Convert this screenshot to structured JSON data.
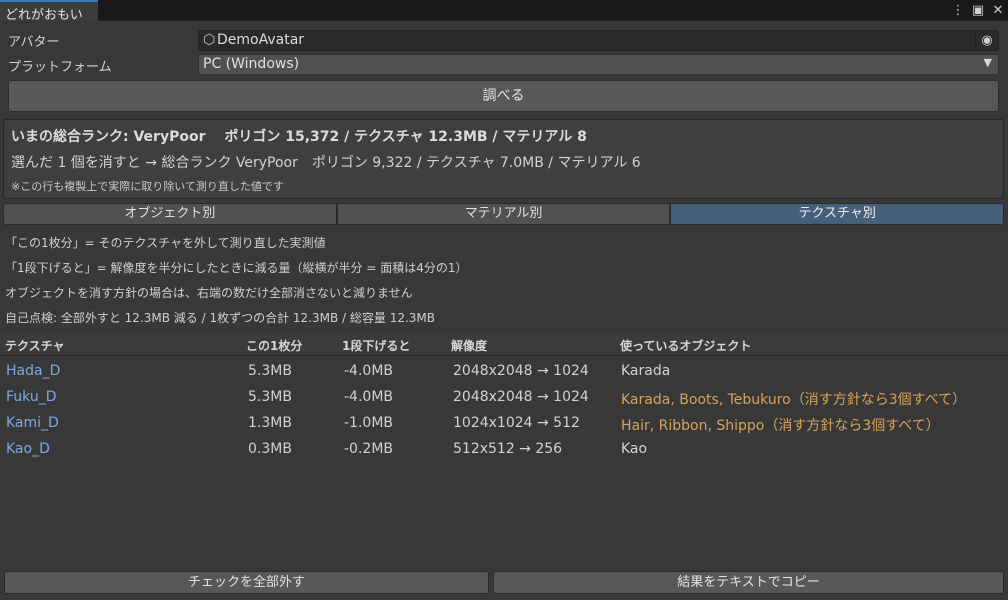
{
  "window": {
    "tab_title": "どれがおもい",
    "icons": [
      "more-vertical-icon",
      "maximize-icon",
      "close-icon"
    ]
  },
  "form": {
    "avatar_label": "アバター",
    "avatar_value": "DemoAvatar",
    "platform_label": "プラットフォーム",
    "platform_value": "PC (Windows)",
    "inspect_button": "調べる"
  },
  "summary": {
    "line1": "いまの総合ランク: VeryPoor　 ポリゴン 15,372 / テクスチャ 12.3MB / マテリアル 8",
    "line2": "選んだ 1 個を消すと → 総合ランク VeryPoor　ポリゴン 9,322 / テクスチャ 7.0MB / マテリアル 6",
    "line3": "※この行も複製上で実際に取り除いて測り直した値です"
  },
  "view_tabs": [
    {
      "label": "オブジェクト別",
      "active": false
    },
    {
      "label": "マテリアル別",
      "active": false
    },
    {
      "label": "テクスチャ別",
      "active": true
    }
  ],
  "notes": [
    "「この1枚分」= そのテクスチャを外して測り直した実測値",
    "「1段下げると」= 解像度を半分にしたときに減る量（縦横が半分 = 面積は4分の1）",
    "オブジェクトを消す方針の場合は、右端の数だけ全部消さないと減りません",
    "自己点検: 全部外すと 12.3MB 減る / 1枚ずつの合計 12.3MB / 総容量 12.3MB"
  ],
  "table": {
    "columns": [
      "テクスチャ",
      "この1枚分",
      "1段下げると",
      "解像度",
      "使っているオブジェクト"
    ],
    "rows": [
      {
        "name": "Hada_D",
        "size": "5.3MB",
        "downgrade": "-4.0MB",
        "resolution": "2048x2048 → 1024",
        "objects": "Karada",
        "warn": false
      },
      {
        "name": "Fuku_D",
        "size": "5.3MB",
        "downgrade": "-4.0MB",
        "resolution": "2048x2048 → 1024",
        "objects": "Karada, Boots, Tebukuro（消す方針なら3個すべて）",
        "warn": true
      },
      {
        "name": "Kami_D",
        "size": "1.3MB",
        "downgrade": "-1.0MB",
        "resolution": "1024x1024 → 512",
        "objects": "Hair, Ribbon, Shippo（消す方針なら3個すべて）",
        "warn": true
      },
      {
        "name": "Kao_D",
        "size": "0.3MB",
        "downgrade": "-0.2MB",
        "resolution": "512x512 → 256",
        "objects": "Kao",
        "warn": false
      }
    ]
  },
  "footer": {
    "uncheck_all": "チェックを全部外す",
    "copy_text": "結果をテキストでコピー"
  },
  "colors": {
    "background": "#383838",
    "link": "#7fa8e0",
    "warning": "#d7a259",
    "active_tab": "#46607c",
    "tab_accent": "#3a79bb"
  }
}
